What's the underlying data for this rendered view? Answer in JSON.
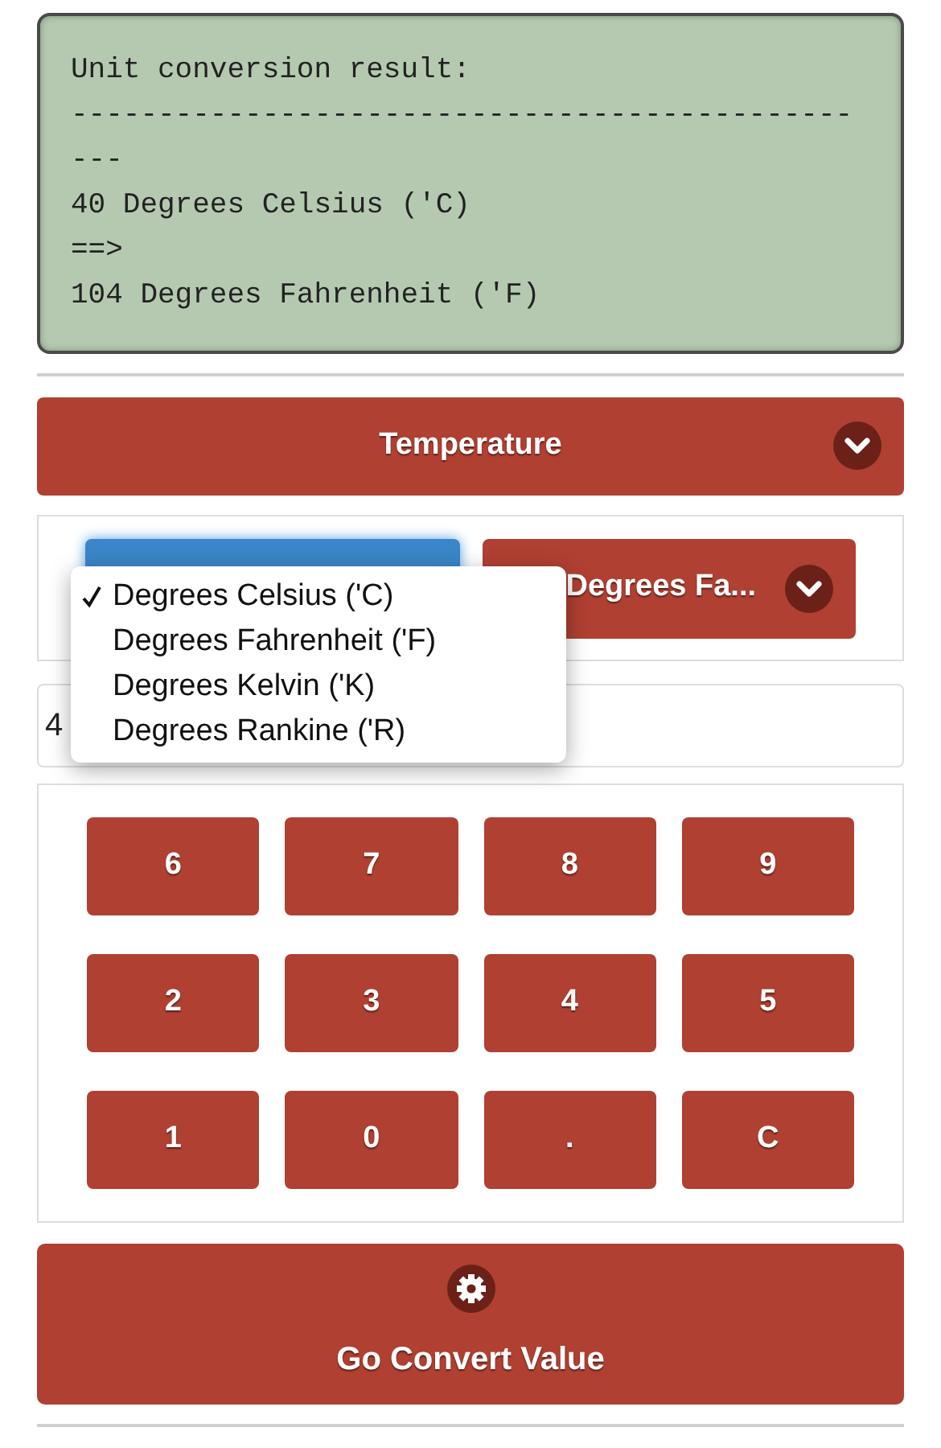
{
  "result": {
    "lines": [
      "Unit conversion result:",
      "---------------------------------------------",
      "---",
      "40 Degrees Celsius ('C)",
      "==>",
      "104 Degrees Fahrenheit ('F)"
    ]
  },
  "category": {
    "label": "Temperature"
  },
  "unit_to": {
    "label": "Degrees Fa..."
  },
  "unit_from_menu": {
    "options": [
      {
        "label": "Degrees Celsius ('C)",
        "selected": true
      },
      {
        "label": "Degrees Fahrenheit ('F)",
        "selected": false
      },
      {
        "label": "Degrees Kelvin ('K)",
        "selected": false
      },
      {
        "label": "Degrees Rankine ('R)",
        "selected": false
      }
    ]
  },
  "value_field": {
    "value": "4"
  },
  "keypad": {
    "keys": [
      "6",
      "7",
      "8",
      "9",
      "2",
      "3",
      "4",
      "5",
      "1",
      "0",
      ".",
      "C"
    ]
  },
  "convert_button": {
    "label": "Go Convert Value"
  }
}
